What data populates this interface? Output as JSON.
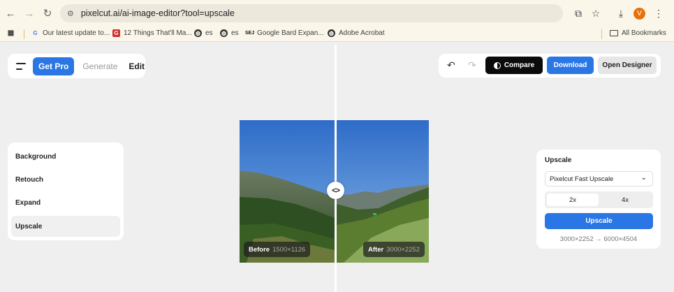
{
  "browser": {
    "url": "pixelcut.ai/ai-image-editor?tool=upscale",
    "avatar_letter": "V",
    "bookmarks": [
      "Our latest update to...",
      "12 Things That'll Ma...",
      "es",
      "es",
      "Google Bard Expan...",
      "Adobe Acrobat"
    ],
    "all_bookmarks": "All Bookmarks"
  },
  "header": {
    "get_pro": "Get Pro",
    "generate": "Generate",
    "edit": "Edit",
    "compare": "Compare",
    "download": "Download",
    "open_designer": "Open Designer"
  },
  "sidebar": {
    "items": [
      "Background",
      "Retouch",
      "Expand",
      "Upscale"
    ],
    "active": "Upscale"
  },
  "image": {
    "before_label": "Before",
    "before_size": "1500×1126",
    "after_label": "After",
    "after_size": "3000×2252"
  },
  "upscale_panel": {
    "title": "Upscale",
    "model": "Pixelcut Fast Upscale",
    "options": [
      "2x",
      "4x"
    ],
    "selected_option": "2x",
    "button": "Upscale",
    "resolution": "3000×2252 → 6000×4504"
  },
  "colors": {
    "accent": "#2b76e5",
    "compare_bg": "#0b0b0b",
    "page_bg": "#efefef"
  }
}
